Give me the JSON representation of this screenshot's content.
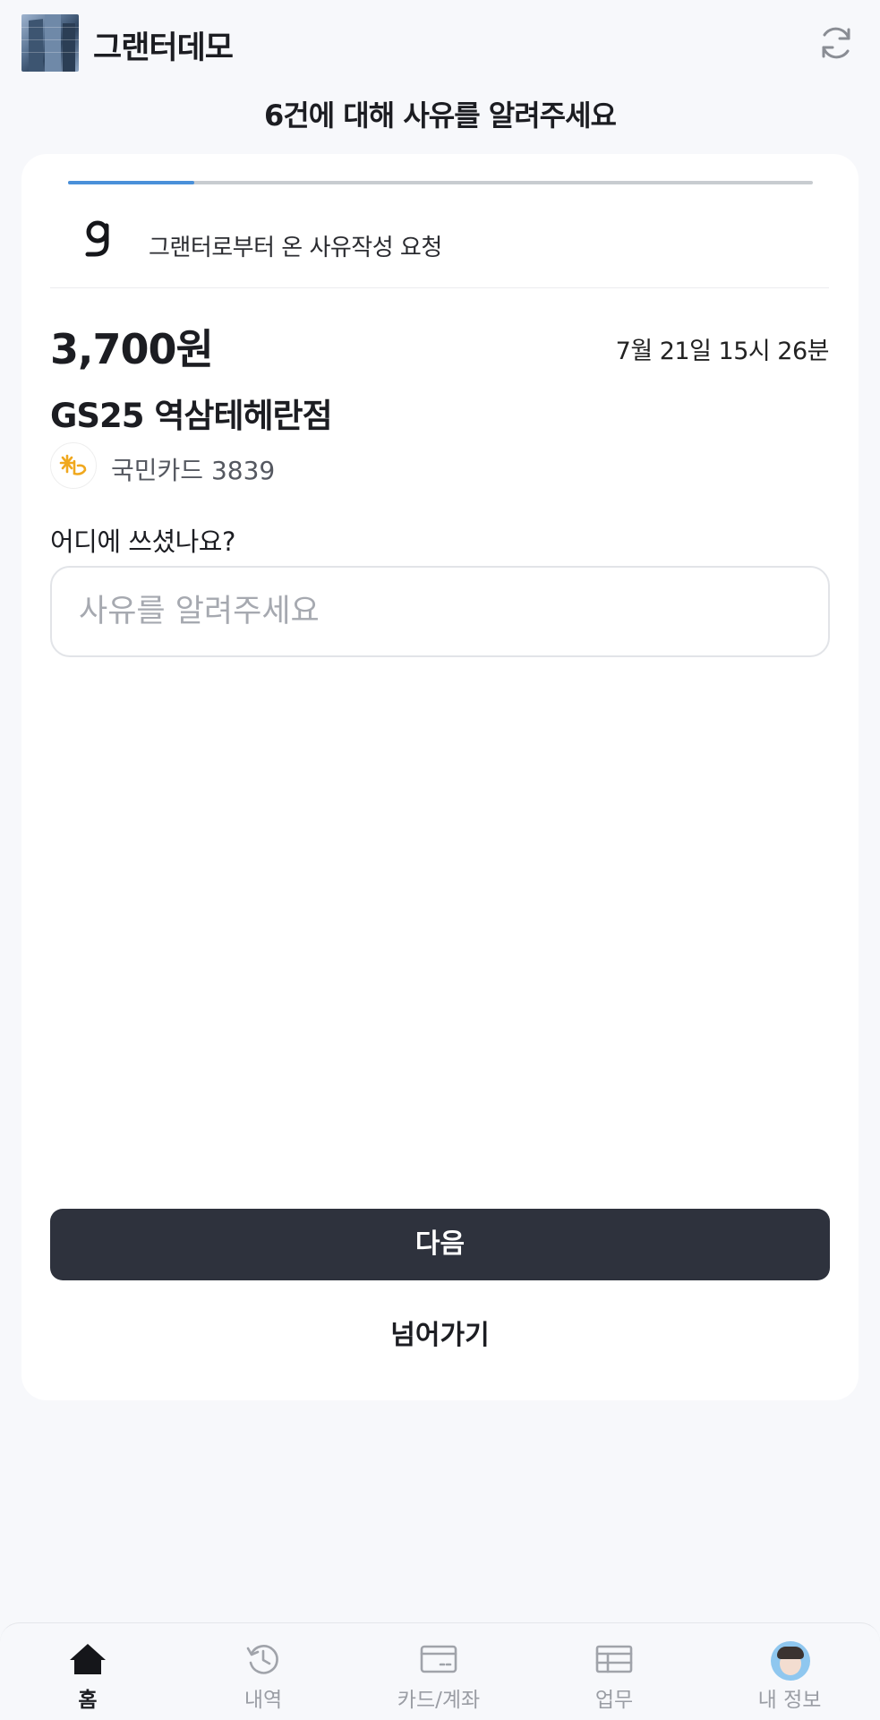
{
  "header": {
    "company_name": "그랜터데모",
    "logo_icon": "building-photo",
    "refresh_icon": "refresh-icon"
  },
  "page_title": "6건에 대해 사유를 알려주세요",
  "progress": {
    "fraction": 0.17,
    "fill_color": "#4a90d9"
  },
  "request": {
    "icon": "granter-g-logo",
    "label": "그랜터로부터 온 사유작성 요청"
  },
  "transaction": {
    "amount": "3,700원",
    "datetime": "7월 21일 15시 26분",
    "merchant": "GS25 역삼테헤란점",
    "card_icon": "kb-card-icon",
    "card_label": "국민카드 3839"
  },
  "form": {
    "question": "어디에 쓰셨나요?",
    "reason_value": "",
    "reason_placeholder": "사유를 알려주세요"
  },
  "actions": {
    "next_label": "다음",
    "skip_label": "넘어가기"
  },
  "nav": {
    "items": [
      {
        "label": "홈",
        "icon": "home-icon",
        "active": true
      },
      {
        "label": "내역",
        "icon": "history-icon",
        "active": false
      },
      {
        "label": "카드/계좌",
        "icon": "card-icon",
        "active": false
      },
      {
        "label": "업무",
        "icon": "table-icon",
        "active": false
      },
      {
        "label": "내 정보",
        "icon": "avatar",
        "active": false
      }
    ]
  },
  "colors": {
    "primary_button": "#2e323d",
    "background": "#f7f8fb",
    "card": "#ffffff",
    "accent": "#4a90d9"
  }
}
